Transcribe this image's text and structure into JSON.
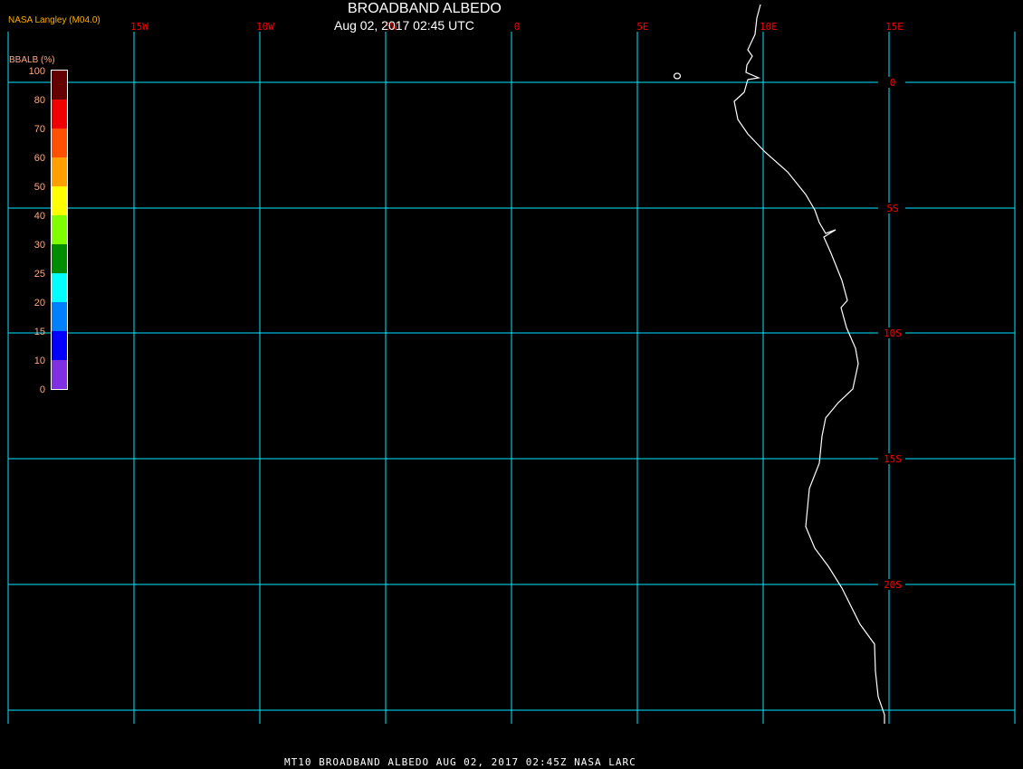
{
  "header": {
    "title": "BROADBAND ALBEDO",
    "subtitle": "Aug 02, 2017 02:45 UTC",
    "credit": "NASA Langley (M04.0)"
  },
  "legend": {
    "title": "BBALB (%)",
    "tick_labels": [
      "100",
      "80",
      "70",
      "60",
      "50",
      "40",
      "30",
      "25",
      "20",
      "15",
      "10",
      "0"
    ],
    "colors": [
      "#640000",
      "#f00000",
      "#ff5000",
      "#ffa000",
      "#ffff00",
      "#80ff00",
      "#008c00",
      "#00ffff",
      "#0080ff",
      "#0000ff",
      "#8030e0"
    ]
  },
  "map": {
    "longitude_labels": [
      "15W",
      "10W",
      "5W",
      "0",
      "5E",
      "10E",
      "15E"
    ],
    "latitude_labels": [
      "0",
      "5S",
      "10S",
      "15S",
      "20S"
    ],
    "grid_color": "#00e8ff",
    "label_color": "#ff0000",
    "coastline_color": "#ffffff"
  },
  "footer": {
    "text": "MT10  BROADBAND ALBEDO   AUG 02, 2017 02:45Z   NASA LARC"
  }
}
